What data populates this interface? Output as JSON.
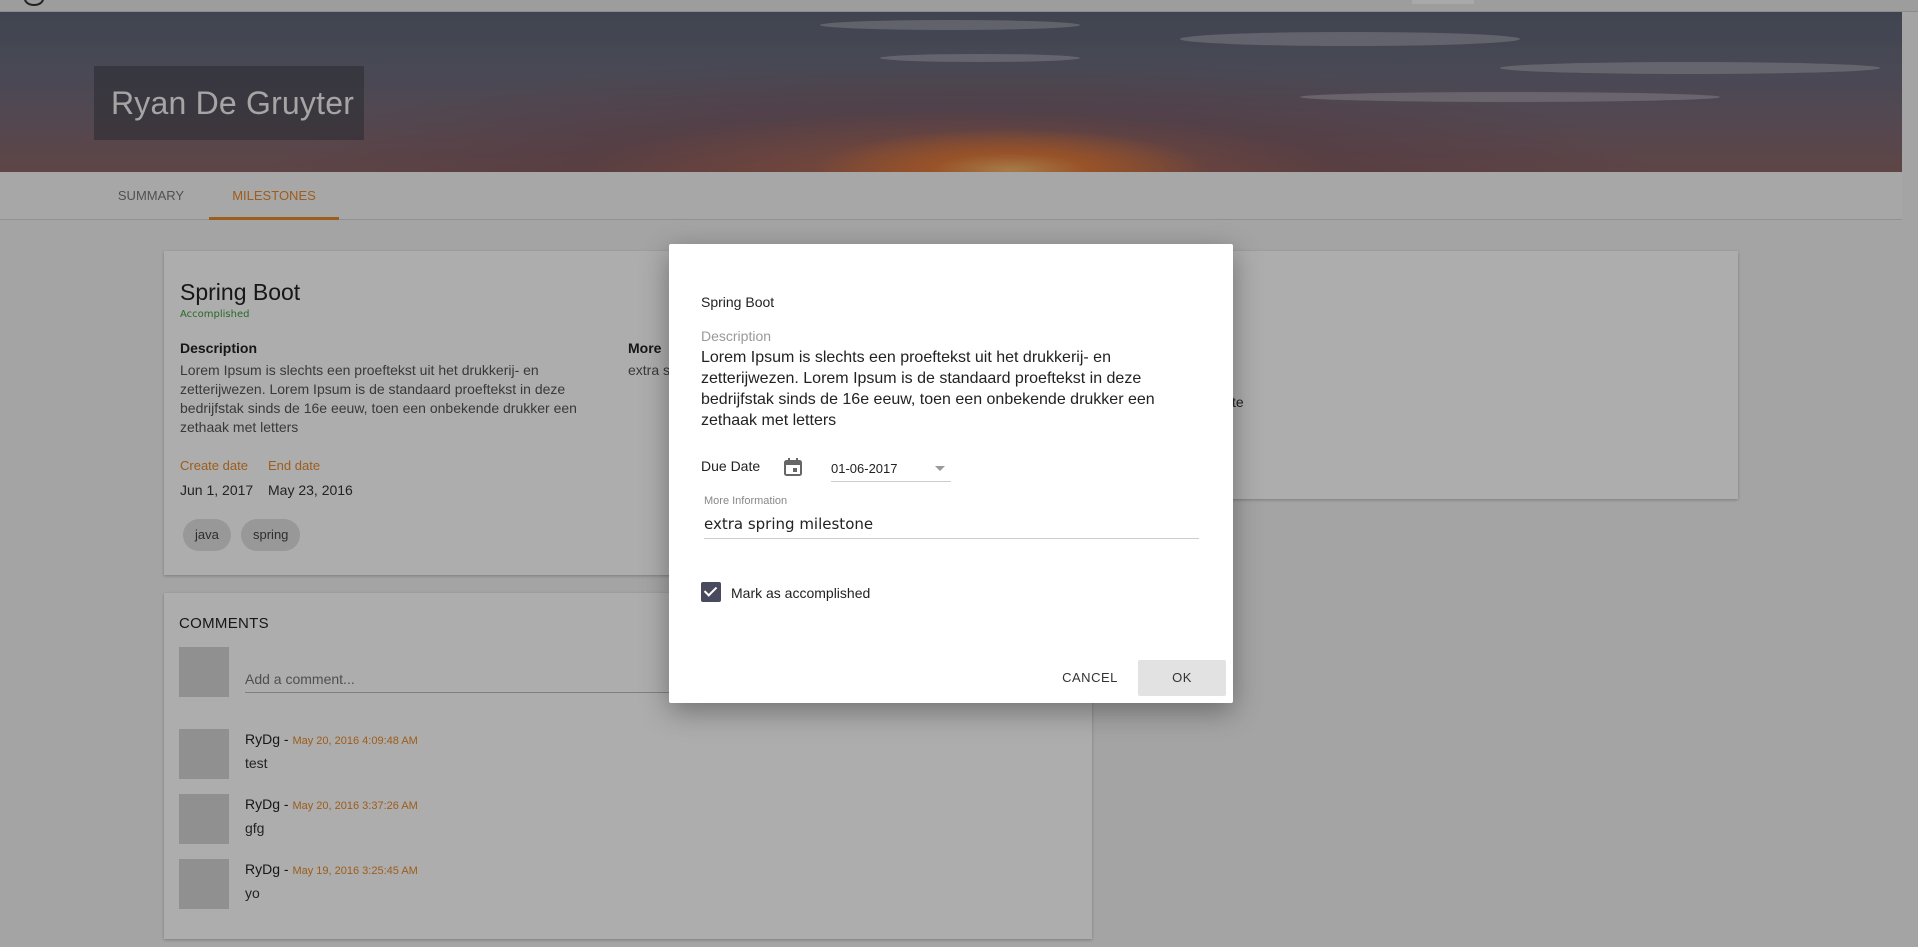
{
  "profile": {
    "name": "Ryan De Gruyter"
  },
  "tabs": [
    {
      "label": "SUMMARY"
    },
    {
      "label": "MILESTONES"
    }
  ],
  "milestone": {
    "title": "Spring Boot",
    "status": "Accomplished",
    "description_label": "Description",
    "description": "Lorem Ipsum is slechts een proeftekst uit het drukkerij- en zetterijwezen. Lorem Ipsum is de standaard proeftekst in deze bedrijfstak sinds de 16e eeuw, toen een onbekende drukker een zethaak met letters",
    "more_label": "More",
    "more_value": "extra s",
    "create_date_label": "Create date",
    "create_date": "Jun 1, 2017",
    "end_date_label": "End date",
    "end_date": "May 23, 2016",
    "tags": [
      "java",
      "spring"
    ]
  },
  "side_card": {
    "text_fragment": "te"
  },
  "comments": {
    "heading": "COMMENTS",
    "placeholder": "Add a comment...",
    "items": [
      {
        "author": "RyDg",
        "separator": " - ",
        "date": "May 20, 2016 4:09:48 AM",
        "text": "test"
      },
      {
        "author": "RyDg",
        "separator": " - ",
        "date": "May 20, 2016 3:37:26 AM",
        "text": "gfg"
      },
      {
        "author": "RyDg",
        "separator": " - ",
        "date": "May 19, 2016 3:25:45 AM",
        "text": "yo"
      }
    ]
  },
  "dialog": {
    "title": "Spring Boot",
    "description_label": "Description",
    "description": "Lorem Ipsum is slechts een proeftekst uit het drukkerij- en zetterijwezen. Lorem Ipsum is de standaard proeftekst in deze bedrijfstak sinds de 16e eeuw, toen een onbekende drukker een zethaak met letters",
    "due_date_label": "Due Date",
    "due_date_value": "01-06-2017",
    "more_info_label": "More Information",
    "more_info_value": "extra spring milestone",
    "accomplished_label": "Mark as accomplished",
    "accomplished_checked": true,
    "cancel_label": "CANCEL",
    "ok_label": "OK"
  },
  "colors": {
    "accent": "#e8892a",
    "status_green": "#3d9a3d",
    "checkbox": "#4a4a5e"
  }
}
